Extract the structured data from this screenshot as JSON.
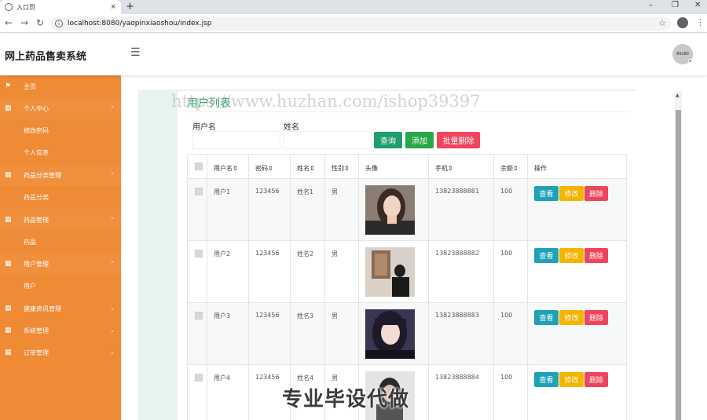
{
  "browser": {
    "tab_title": "入口页",
    "tab_close": "×",
    "new_tab": "+",
    "url": "localhost:8080/yaopinxiaoshou/index.jsp",
    "win_min": "–",
    "win_max": "❐",
    "win_close": "✕"
  },
  "header": {
    "app_title": "网上药品售卖系统",
    "avatar_text": "80x80"
  },
  "sidebar": {
    "items": [
      {
        "label": "主页",
        "type": "top",
        "icon": "flag-icon"
      },
      {
        "label": "个人中心",
        "type": "group",
        "icon": "grid-icon",
        "expanded": true
      },
      {
        "label": "修改密码",
        "type": "sub"
      },
      {
        "label": "个人信息",
        "type": "sub"
      },
      {
        "label": "药品分类管理",
        "type": "group",
        "icon": "grid-icon",
        "expanded": true
      },
      {
        "label": "药品分类",
        "type": "sub"
      },
      {
        "label": "药品管理",
        "type": "group",
        "icon": "grid-icon",
        "expanded": true
      },
      {
        "label": "药品",
        "type": "sub"
      },
      {
        "label": "用户管理",
        "type": "group",
        "icon": "grid-icon",
        "expanded": true
      },
      {
        "label": "用户",
        "type": "sub"
      },
      {
        "label": "健康资讯管理",
        "type": "top",
        "icon": "grid-icon",
        "expanded": false
      },
      {
        "label": "系统管理",
        "type": "top",
        "icon": "grid-icon",
        "expanded": false
      },
      {
        "label": "订单管理",
        "type": "top",
        "icon": "grid-icon",
        "expanded": false
      }
    ]
  },
  "main": {
    "page_title": "用户列表",
    "watermark": "https://www.huzhan.com/ishop39397",
    "filters": {
      "username_label": "用户名",
      "name_label": "姓名",
      "username_value": "",
      "name_value": ""
    },
    "buttons": {
      "search": "查询",
      "add": "添加",
      "batch_delete": "批量删除"
    },
    "table": {
      "columns": [
        "用户名",
        "密码",
        "姓名",
        "性别",
        "头像",
        "手机",
        "余额",
        "操作"
      ],
      "sortable_marker": "⇕",
      "rows": [
        {
          "username": "用户1",
          "password": "123456",
          "name": "姓名1",
          "gender": "男",
          "phone": "13823888881",
          "balance": "100"
        },
        {
          "username": "用户2",
          "password": "123456",
          "name": "姓名2",
          "gender": "男",
          "phone": "13823888882",
          "balance": "100"
        },
        {
          "username": "用户3",
          "password": "123456",
          "name": "姓名3",
          "gender": "男",
          "phone": "13823888883",
          "balance": "100"
        },
        {
          "username": "用户4",
          "password": "123456",
          "name": "姓名4",
          "gender": "男",
          "phone": "13823888884",
          "balance": "100"
        }
      ],
      "actions": {
        "view": "查看",
        "edit": "修改",
        "delete": "删除"
      }
    },
    "overlay_text": "专业毕设代做"
  },
  "colors": {
    "sidebar": "#ef8a35",
    "btn_search": "#1e9e6b",
    "btn_add": "#27a745",
    "btn_delete": "#f0445c",
    "btn_view": "#1fa2b8",
    "btn_edit": "#f5b400"
  }
}
